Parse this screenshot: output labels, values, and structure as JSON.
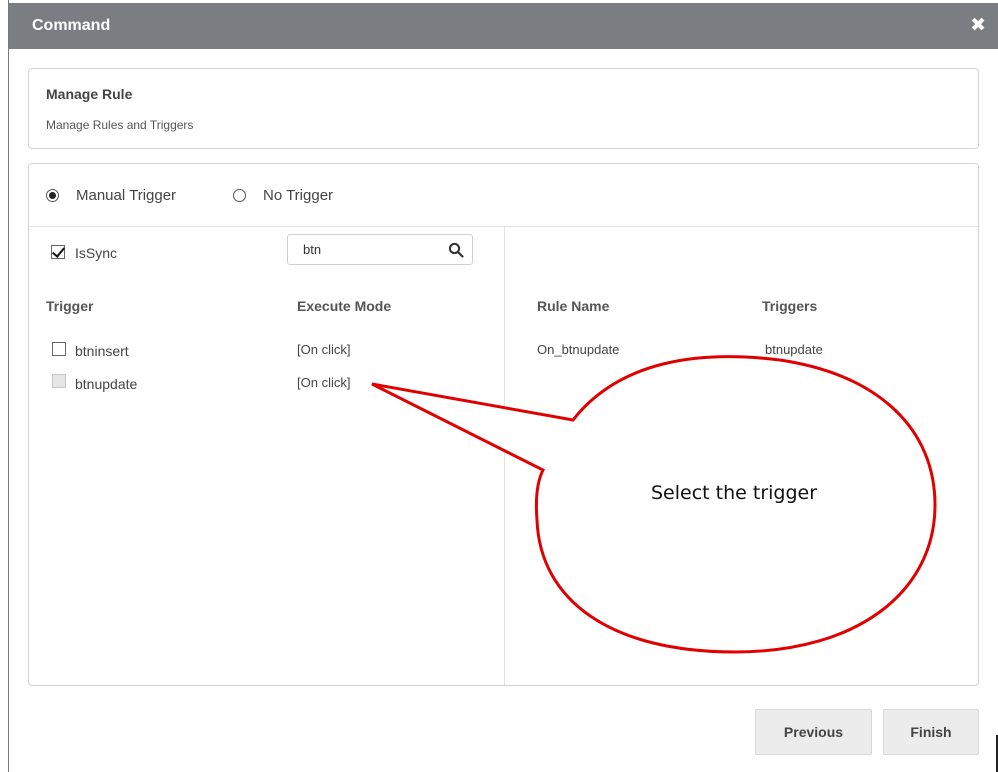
{
  "dialog": {
    "title": "Command",
    "close_glyph": "✖"
  },
  "header": {
    "title": "Manage Rule",
    "subtitle": "Manage Rules and Triggers"
  },
  "trigger_mode": {
    "options": [
      {
        "label": "Manual Trigger",
        "selected": true
      },
      {
        "label": "No Trigger",
        "selected": false
      }
    ]
  },
  "left_panel": {
    "issync": {
      "label": "IsSync",
      "checked": true
    },
    "search": {
      "value": "btn",
      "icon": "search-icon"
    },
    "columns": {
      "trigger": "Trigger",
      "execute_mode": "Execute Mode"
    },
    "rows": [
      {
        "name": "btninsert",
        "mode": "[On click]",
        "checked": false,
        "disabled": false
      },
      {
        "name": "btnupdate",
        "mode": "[On click]",
        "checked": false,
        "disabled": true
      }
    ]
  },
  "right_panel": {
    "columns": {
      "rule_name": "Rule Name",
      "triggers": "Triggers"
    },
    "rows": [
      {
        "rule_name": "On_btnupdate",
        "triggers": "btnupdate"
      }
    ]
  },
  "buttons": {
    "previous": "Previous",
    "finish": "Finish"
  },
  "annotation": {
    "text": "Select the trigger",
    "color": "#e00000"
  },
  "colors": {
    "titlebar": "#7a7d82"
  }
}
